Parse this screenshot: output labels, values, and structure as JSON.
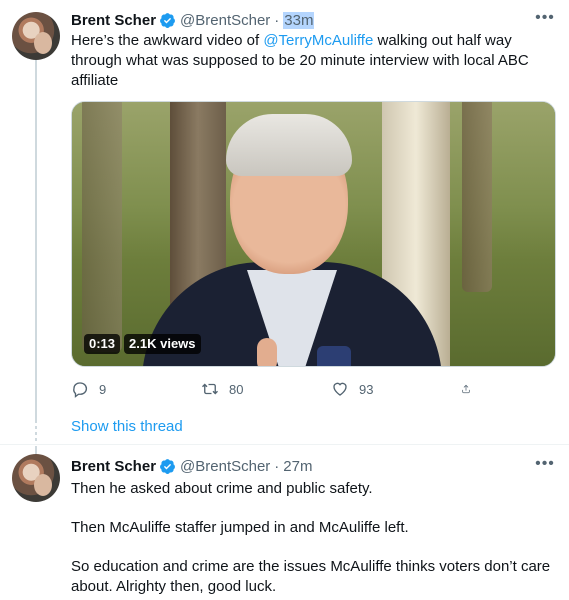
{
  "tweets": [
    {
      "author": "Brent Scher",
      "handle": "@BrentScher",
      "separator": "·",
      "time": "33m",
      "text_before": "Here’s the awkward video of ",
      "mention": "@TerryMcAuliffe",
      "text_after": " walking out half way through what was supposed to be 20 minute interview with local ABC affiliate",
      "video": {
        "duration": "0:13",
        "views": "2.1K views"
      },
      "replies": "9",
      "retweets": "80",
      "likes": "93",
      "show_thread": "Show this thread",
      "more": "•••"
    },
    {
      "author": "Brent Scher",
      "handle": "@BrentScher",
      "separator": "·",
      "time": "27m",
      "paragraphs": [
        "Then he asked about crime and public safety.",
        "Then McAuliffe staffer jumped in and McAuliffe left.",
        "So education and crime are the issues McAuliffe thinks voters don’t care about. Alrighty then, good luck."
      ],
      "more": "•••"
    }
  ],
  "colors": {
    "accent": "#1d9bf0",
    "text": "#0f1419",
    "secondary": "#536471",
    "selection": "#b4d5fe"
  }
}
